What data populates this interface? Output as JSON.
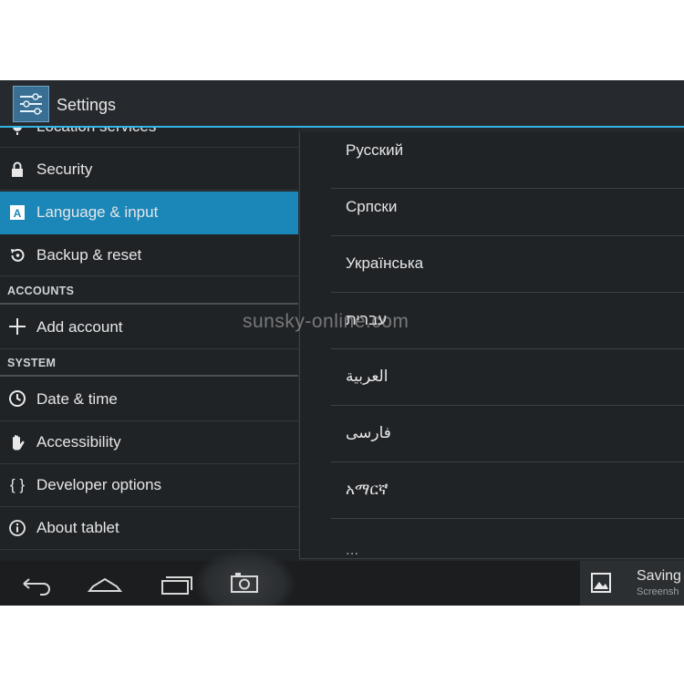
{
  "action_bar": {
    "title": "Settings"
  },
  "left_list": {
    "location_services": "Location services",
    "security": "Security",
    "language_input": "Language & input",
    "backup_reset": "Backup & reset",
    "accounts_header": "ACCOUNTS",
    "add_account": "Add account",
    "system_header": "SYSTEM",
    "date_time": "Date & time",
    "accessibility": "Accessibility",
    "developer_options": "Developer options",
    "about_tablet": "About tablet"
  },
  "language_menu": {
    "items": [
      "Русский",
      "Српски",
      "Українська",
      "עברית",
      "العربية",
      "فارسی",
      "አማርኛ"
    ],
    "partial_item": "..."
  },
  "watermark": "sunsky-online.com",
  "notification": {
    "title": "Saving",
    "subtitle": "Screensh"
  },
  "colors": {
    "accent": "#33b5e5",
    "selected": "#1b87b9",
    "background": "#202326"
  },
  "icons": {
    "location": "location-icon",
    "security": "lock-icon",
    "language": "language-icon",
    "backup": "restore-icon",
    "add_account": "plus-icon",
    "date_time": "clock-icon",
    "accessibility": "hand-icon",
    "developer": "braces-icon",
    "about": "info-icon"
  }
}
